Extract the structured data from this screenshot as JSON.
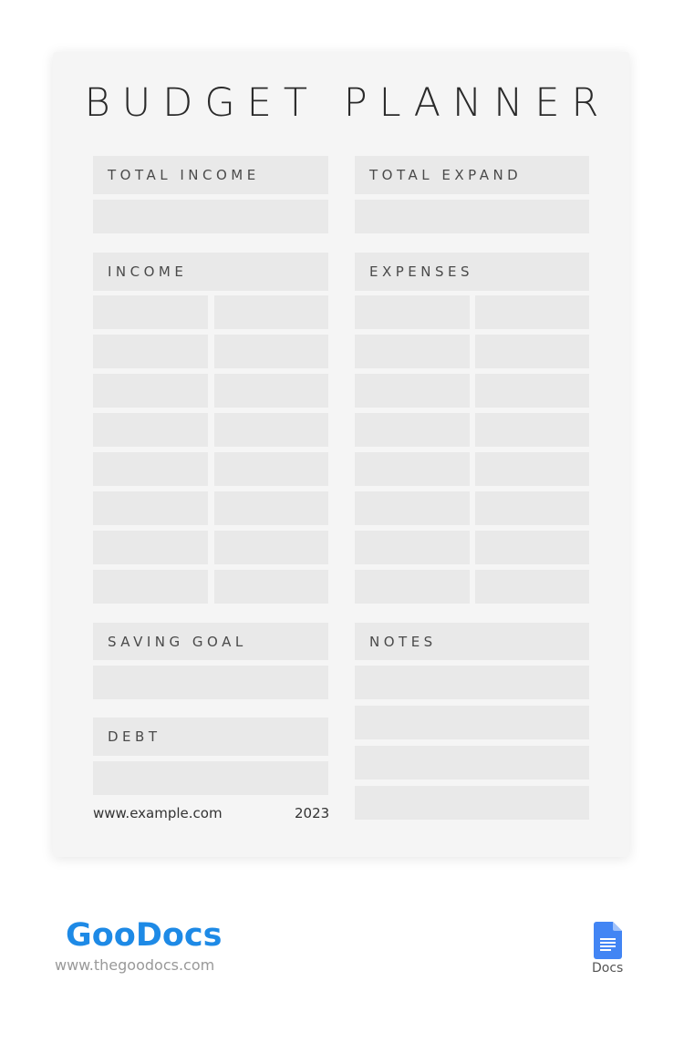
{
  "document": {
    "title": "BUDGET PLANNER",
    "sections": {
      "total_income": "TOTAL INCOME",
      "total_expand": "TOTAL EXPAND",
      "income": "INCOME",
      "expenses": "EXPENSES",
      "saving_goal": "SAVING GOAL",
      "debt": "DEBT",
      "notes": "NOTES"
    },
    "income_rows": 8,
    "expense_rows": 8,
    "notes_lines": 4,
    "footer": {
      "website": "www.example.com",
      "year": "2023"
    }
  },
  "branding": {
    "logo": "GooDocs",
    "url": "www.thegoodocs.com",
    "app_label": "Docs",
    "app_icon": "google-docs-icon",
    "colors": {
      "logo": "#1e8ae6",
      "docs_icon": "#4285f4",
      "cell": "#e9e9e9",
      "card": "#f5f5f5"
    }
  }
}
